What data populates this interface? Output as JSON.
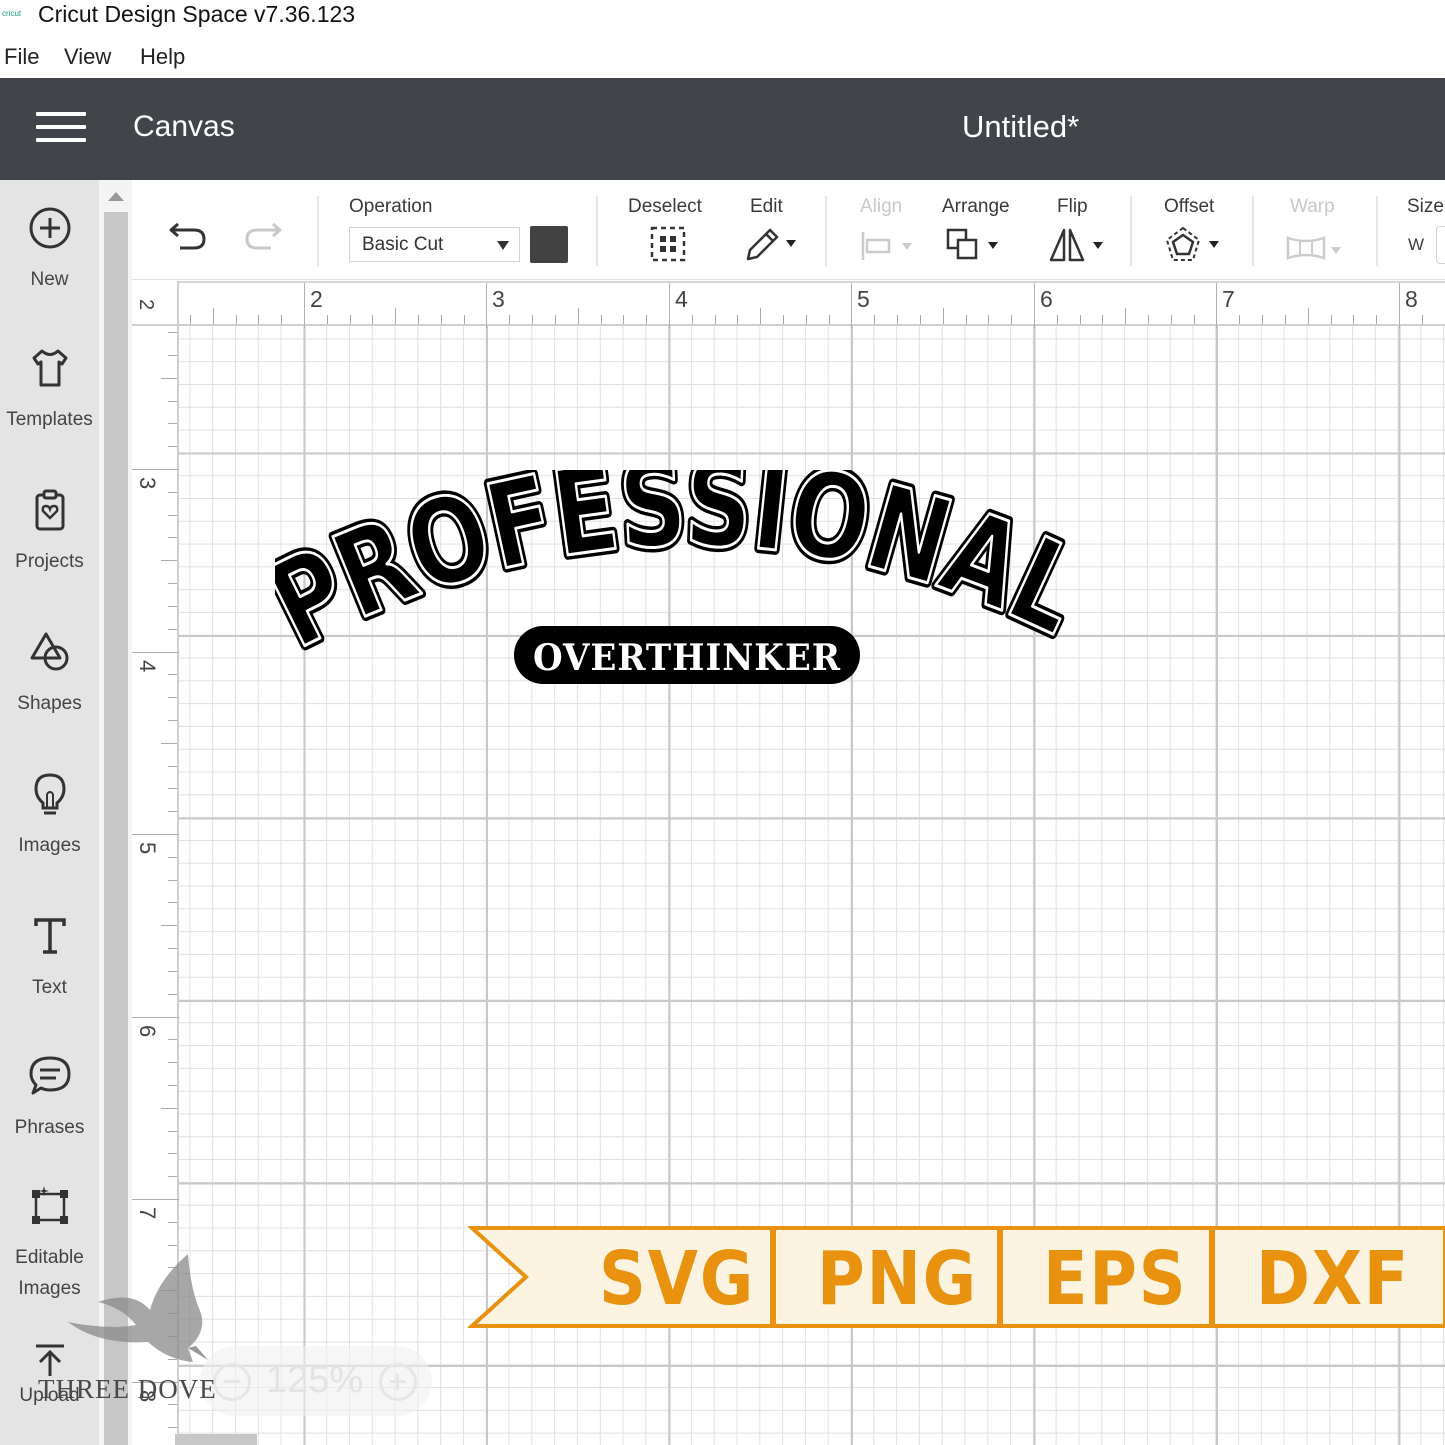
{
  "window": {
    "title": "Cricut Design Space  v7.36.123",
    "icon": "cricut-logo-icon"
  },
  "menubar": {
    "items": [
      "File",
      "View",
      "Help"
    ]
  },
  "header": {
    "section": "Canvas",
    "document_title": "Untitled*"
  },
  "sidebar": {
    "items": [
      {
        "label": "New",
        "icon": "plus-circle-icon"
      },
      {
        "label": "Templates",
        "icon": "tshirt-icon"
      },
      {
        "label": "Projects",
        "icon": "clipboard-icon"
      },
      {
        "label": "Shapes",
        "icon": "shapes-icon"
      },
      {
        "label": "Images",
        "icon": "lightbulb-icon"
      },
      {
        "label": "Text",
        "icon": "text-t-icon"
      },
      {
        "label": "Phrases",
        "icon": "speech-bubble-icon"
      },
      {
        "label": "Editable",
        "label2": "Images",
        "icon": "editable-image-icon"
      },
      {
        "label": "Upload",
        "icon": "upload-arrow-icon"
      }
    ]
  },
  "toolbar": {
    "operation_label": "Operation",
    "operation_value": "Basic Cut",
    "operation_color": "#424242",
    "deselect_label": "Deselect",
    "edit_label": "Edit",
    "align_label": "Align",
    "arrange_label": "Arrange",
    "flip_label": "Flip",
    "offset_label": "Offset",
    "warp_label": "Warp",
    "size_label": "Size",
    "size_w_label": "W"
  },
  "ruler": {
    "top": [
      "2",
      "3",
      "4",
      "5",
      "6",
      "7",
      "8"
    ],
    "left": [
      "2",
      "3",
      "4",
      "5",
      "6",
      "7",
      "8"
    ]
  },
  "design": {
    "title": "PROFESSIONAL",
    "subtitle": "OVERTHINKER",
    "color": "#000000"
  },
  "formats": {
    "items": [
      "SVG",
      "PNG",
      "EPS",
      "DXF"
    ],
    "color": "#e8920f",
    "background": "#fdf3e1"
  },
  "zoom": {
    "value": "125%"
  },
  "watermark": {
    "text": "THREE DOVE"
  }
}
